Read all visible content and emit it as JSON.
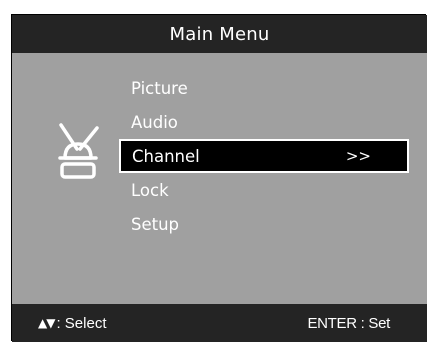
{
  "header": {
    "title": "Main Menu"
  },
  "menu": {
    "icon": "channel-antenna-icon",
    "items": [
      {
        "label": "Picture",
        "selected": false
      },
      {
        "label": "Audio",
        "selected": false
      },
      {
        "label": "Channel",
        "selected": true,
        "indicator": ">>"
      },
      {
        "label": "Lock",
        "selected": false
      },
      {
        "label": "Setup",
        "selected": false
      }
    ]
  },
  "footer": {
    "nav_arrows": "▲▼",
    "nav_text": ": Select",
    "enter_text": "ENTER : Set"
  },
  "colors": {
    "header_bg": "#242424",
    "panel_bg": "#a0a0a0",
    "selected_bg": "#000000",
    "text": "#ffffff"
  }
}
